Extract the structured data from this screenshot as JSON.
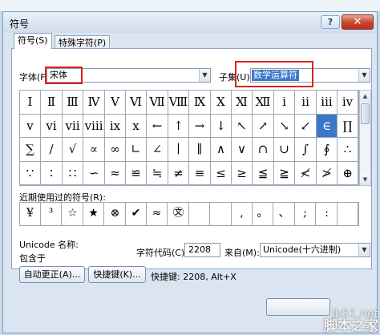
{
  "dialog": {
    "title": "符号",
    "help_label": "?",
    "close_label": "✕"
  },
  "tabs": [
    "符号(S)",
    "特殊字符(P)"
  ],
  "font": {
    "label": "字体(F):",
    "value": "宋体"
  },
  "subset": {
    "label": "子集(U):",
    "value": "数学运算符"
  },
  "symbols": [
    [
      "Ⅰ",
      "Ⅱ",
      "Ⅲ",
      "Ⅳ",
      "Ⅴ",
      "Ⅵ",
      "Ⅶ",
      "Ⅷ",
      "Ⅸ",
      "Ⅹ",
      "Ⅺ",
      "Ⅻ",
      "ⅰ",
      "ⅱ",
      "ⅲ",
      "ⅳ"
    ],
    [
      "ⅴ",
      "ⅵ",
      "ⅶ",
      "ⅷ",
      "ⅸ",
      "ⅹ",
      "←",
      "↑",
      "→",
      "↓",
      "↖",
      "↗",
      "↘",
      "↙",
      "∈",
      "∏"
    ],
    [
      "∑",
      "∕",
      "√",
      "∝",
      "∞",
      "∟",
      "∠",
      "∣",
      "∥",
      "∧",
      "∨",
      "∩",
      "∪",
      "∫",
      "∮",
      "∴"
    ],
    [
      "∵",
      "∶",
      "∷",
      "∽",
      "≈",
      "≌",
      "≒",
      "≠",
      "≡",
      "≤",
      "≥",
      "≦",
      "≧",
      "≮",
      "≯",
      "⊕"
    ]
  ],
  "selected_symbol": "∈",
  "recent": {
    "label": "近期使用过的符号(R):",
    "symbols": [
      "¥",
      "³",
      "☆",
      "★",
      "⊗",
      "✔",
      "≈",
      "㉆",
      "",
      "",
      ",",
      "。",
      "、",
      ";",
      ":",
      ""
    ]
  },
  "unicode_name_label": "Unicode 名称:",
  "unicode_name_value": "包含于",
  "char_code": {
    "label": "字符代码(C):",
    "value": "2208"
  },
  "from": {
    "label": "来自(M):",
    "value": "Unicode(十六进制)"
  },
  "buttons": {
    "autocorrect": "自动更正(A)...",
    "shortcut": "快捷键(K)..."
  },
  "shortcut_text": "快捷键: 2208, Alt+X",
  "watermark": {
    "line1": "jb51.net",
    "line2": "脚本之家"
  }
}
